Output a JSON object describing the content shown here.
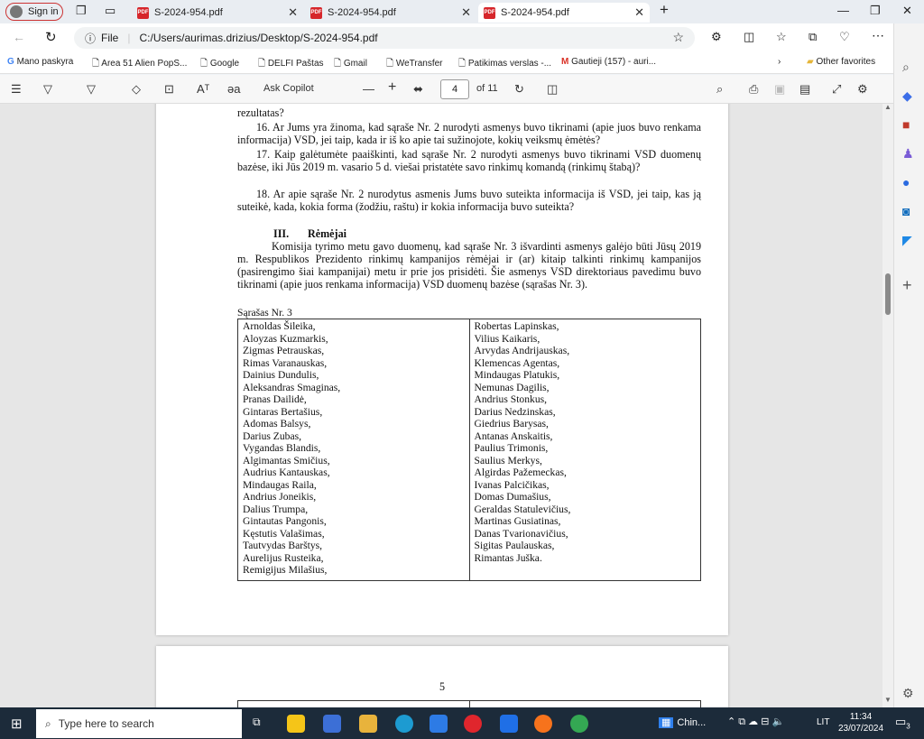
{
  "tabs": [
    {
      "label": "S-2024-954.pdf"
    },
    {
      "label": "S-2024-954.pdf"
    },
    {
      "label": "S-2024-954.pdf"
    }
  ],
  "signin_label": "Sign in",
  "address": {
    "scheme": "File",
    "url": "C:/Users/aurimas.drizius/Desktop/S-2024-954.pdf"
  },
  "favorites": [
    {
      "label": "Mano paskyra"
    },
    {
      "label": "Area 51 Alien PopS..."
    },
    {
      "label": "Google"
    },
    {
      "label": "DELFI Paštas"
    },
    {
      "label": "Gmail"
    },
    {
      "label": "WeTransfer"
    },
    {
      "label": "Patikimas verslas -..."
    },
    {
      "label": "Gautieji (157) - auri..."
    },
    {
      "label": "Other favorites"
    }
  ],
  "pdf_toolbar": {
    "ask_copilot": "Ask Copilot",
    "page_current": "4",
    "page_total": "of 11",
    "read_aloud": "Aᵀ",
    "aa": "əa"
  },
  "doc": {
    "p_top": "rezultatas?",
    "q16": "16. Ar Jums yra žinoma, kad sąraše Nr. 2 nurodyti asmenys buvo tikrinami (apie juos buvo renkama informacija) VSD, jei taip, kada ir iš ko apie tai sužinojote, kokių veiksmų ėmėtės?",
    "q17": "17. Kaip galėtumėte paaiškinti, kad sąraše Nr. 2 nurodyti asmenys buvo tikrinami VSD duomenų bazėse, iki Jūs 2019 m. vasario 5 d. viešai pristatėte savo rinkimų komandą (rinkimų štabą)?",
    "q18": "18. Ar apie sąraše Nr. 2 nurodytus asmenis Jums buvo suteikta informacija iš VSD, jei taip, kas ją suteikė, kada, kokia forma (žodžiu, raštu) ir kokia informacija buvo suteikta?",
    "section_num": "III.",
    "section_title": "Rėmėjai",
    "section_text": "Komisija tyrimo metu gavo duomenų, kad sąraše Nr. 3 išvardinti asmenys galėjo būti Jūsų 2019 m. Respublikos Prezidento rinkimų kampanijos rėmėjai ir (ar) kitaip talkinti rinkimų kampanijos (pasirengimo šiai kampanijai) metu ir prie jos prisidėti. Šie asmenys VSD direktoriaus pavedimu buvo tikrinami (apie juos renkama informacija) VSD duomenų bazėse (sąrašas Nr. 3).",
    "list_title": "Sąrašas Nr. 3",
    "col1": [
      "Arnoldas Šileika,",
      "Aloyzas Kuzmarkis,",
      "Zigmas Petrauskas,",
      "Rimas Varanauskas,",
      "Dainius Dundulis,",
      "Aleksandras Smaginas,",
      "Pranas Dailidė,",
      "Gintaras Bertašius,",
      "Adomas Balsys,",
      "Darius Zubas,",
      "Vygandas Blandis,",
      "Algimantas Smičius,",
      "Audrius Kantauskas,",
      "Mindaugas Raila,",
      "Andrius Joneikis,",
      "Dalius Trumpa,",
      "Gintautas Pangonis,",
      "Kęstutis Valašimas,",
      "Tautvydas Barštys,",
      "Aurelijus Rusteika,",
      "Remigijus Milašius,"
    ],
    "col2": [
      "Robertas Lapinskas,",
      "Vilius Kaikaris,",
      "Arvydas Andrijauskas,",
      "Klemencas Agentas,",
      "Mindaugas Platukis,",
      "Nemunas Dagilis,",
      "Andrius Stonkus,",
      "Darius Nedzinskas,",
      "Giedrius Barysas,",
      "Antanas Anskaitis,",
      "Paulius Trimonis,",
      "Saulius Merkys,",
      "Algirdas Pažemeckas,",
      "Ivanas Palcičikas,",
      "Domas Dumašius,",
      "Geraldas Statulevičius,",
      "Martinas Gusiatinas,",
      "Danas Tvarionavičius,",
      "Sigitas Paulauskas,",
      "Rimantas Juška."
    ],
    "next_page_num": "5"
  },
  "taskbar": {
    "search_placeholder": "Type here to search",
    "weather": "Chin...",
    "lang": "LIT",
    "time": "11:34",
    "date": "23/07/2024",
    "notif_count": "3"
  }
}
